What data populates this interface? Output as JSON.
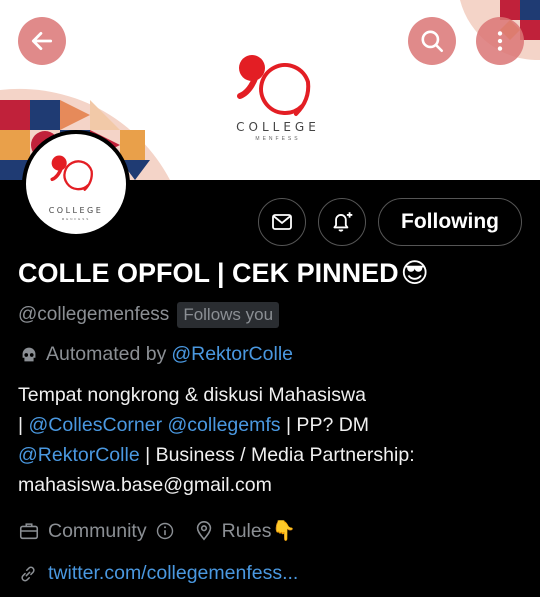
{
  "header": {
    "back_icon": "arrow-left-icon",
    "search_icon": "search-icon",
    "more_icon": "more-vertical-icon"
  },
  "banner": {
    "logo_word": "COLLEGE",
    "logo_sub": "MENFESS",
    "accent_color": "#e31e24"
  },
  "avatar": {
    "logo_word": "COLLEGE",
    "logo_sub": "MENFESS"
  },
  "actions": {
    "mail_icon": "mail-icon",
    "notify_icon": "bell-plus-icon",
    "follow_label": "Following"
  },
  "profile": {
    "name": "COLLE OPFOL | CEK PINNED",
    "name_emoji": "😎",
    "handle": "@collegemenfess",
    "follows_you": "Follows you",
    "automated_prefix": "Automated by",
    "automated_link": "@RektorColle",
    "bio": {
      "line1": "Tempat nongkrong & diskusi Mahasiswa",
      "sep1": "|",
      "link1": "@CollesCorner",
      "link2": "@collegemfs",
      "text2": "| PP? DM",
      "link3": "@RektorColle",
      "text3": "| Business / Media Partnership:",
      "line4": "mahasiswa.base@gmail.com"
    },
    "category": "Community",
    "info_icon": "info-icon",
    "location": "Rules",
    "location_emoji": "👇",
    "website": "twitter.com/collegemenfess..."
  }
}
